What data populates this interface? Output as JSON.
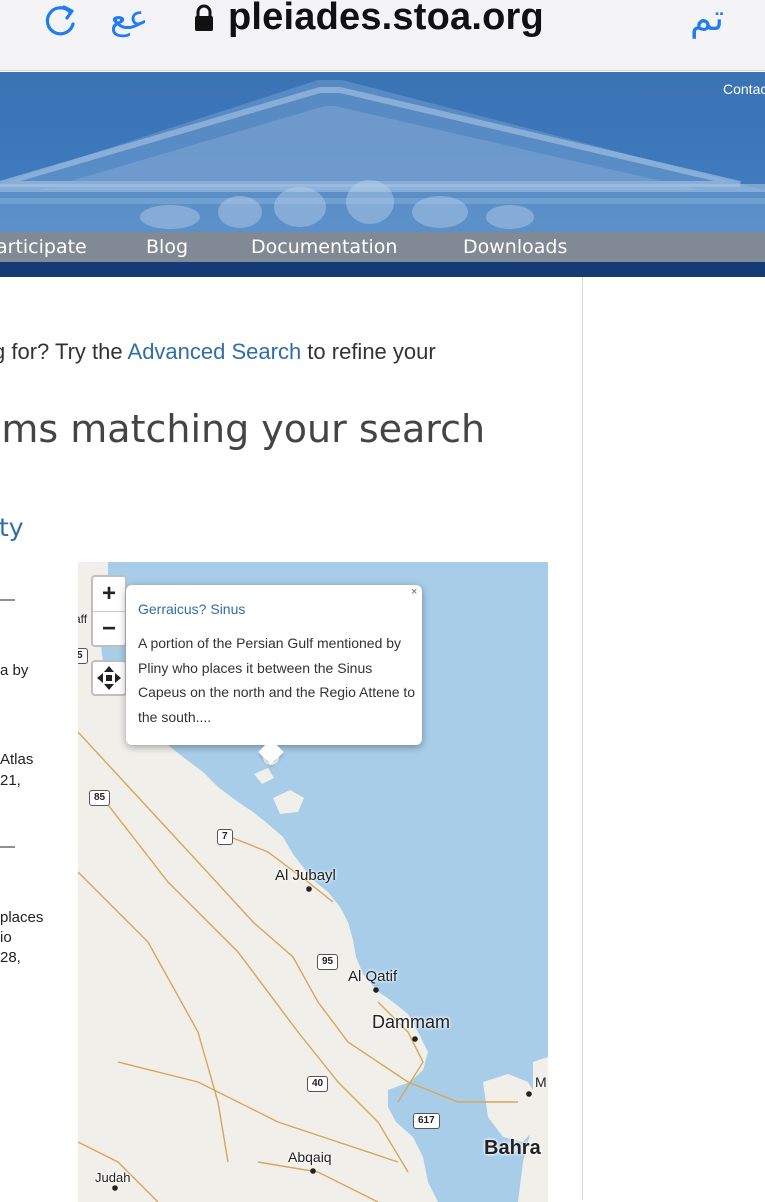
{
  "browser": {
    "text_size_label": "عع",
    "host": "pleiades.stoa.org",
    "done_label": "تم"
  },
  "header": {
    "contact_label": "Contac",
    "nav": [
      "articipate",
      "Blog",
      "Documentation",
      "Downloads"
    ]
  },
  "content": {
    "hint_prefix": "g for? Try the ",
    "hint_link": "Advanced Search",
    "hint_suffix": " to refine your",
    "heading": "ems matching your search",
    "result_link": "ity",
    "fragments": [
      "—",
      "a by",
      "Atlas",
      "21,",
      "—",
      "places",
      "io",
      "28,"
    ]
  },
  "map": {
    "zoom_in": "+",
    "zoom_out": "−",
    "popup": {
      "close": "×",
      "title": "Gerraicus? Sinus",
      "description": "A portion of the Persian Gulf mentioned by Pliny who places it between the Sinus Capeus on the north and the Regio Attene to the south...."
    },
    "road_shields": [
      "85",
      "7",
      "95",
      "40",
      "617",
      "5"
    ],
    "places": [
      "aff",
      "Al Jubayl",
      "Al Qatif",
      "Dammam",
      "Abqaiq",
      "Judah",
      "Bahra",
      "M"
    ],
    "colors": {
      "water": "#a8cde9",
      "land": "#f1efea",
      "road": "#d9a55b",
      "marker": "#f0a030"
    }
  }
}
